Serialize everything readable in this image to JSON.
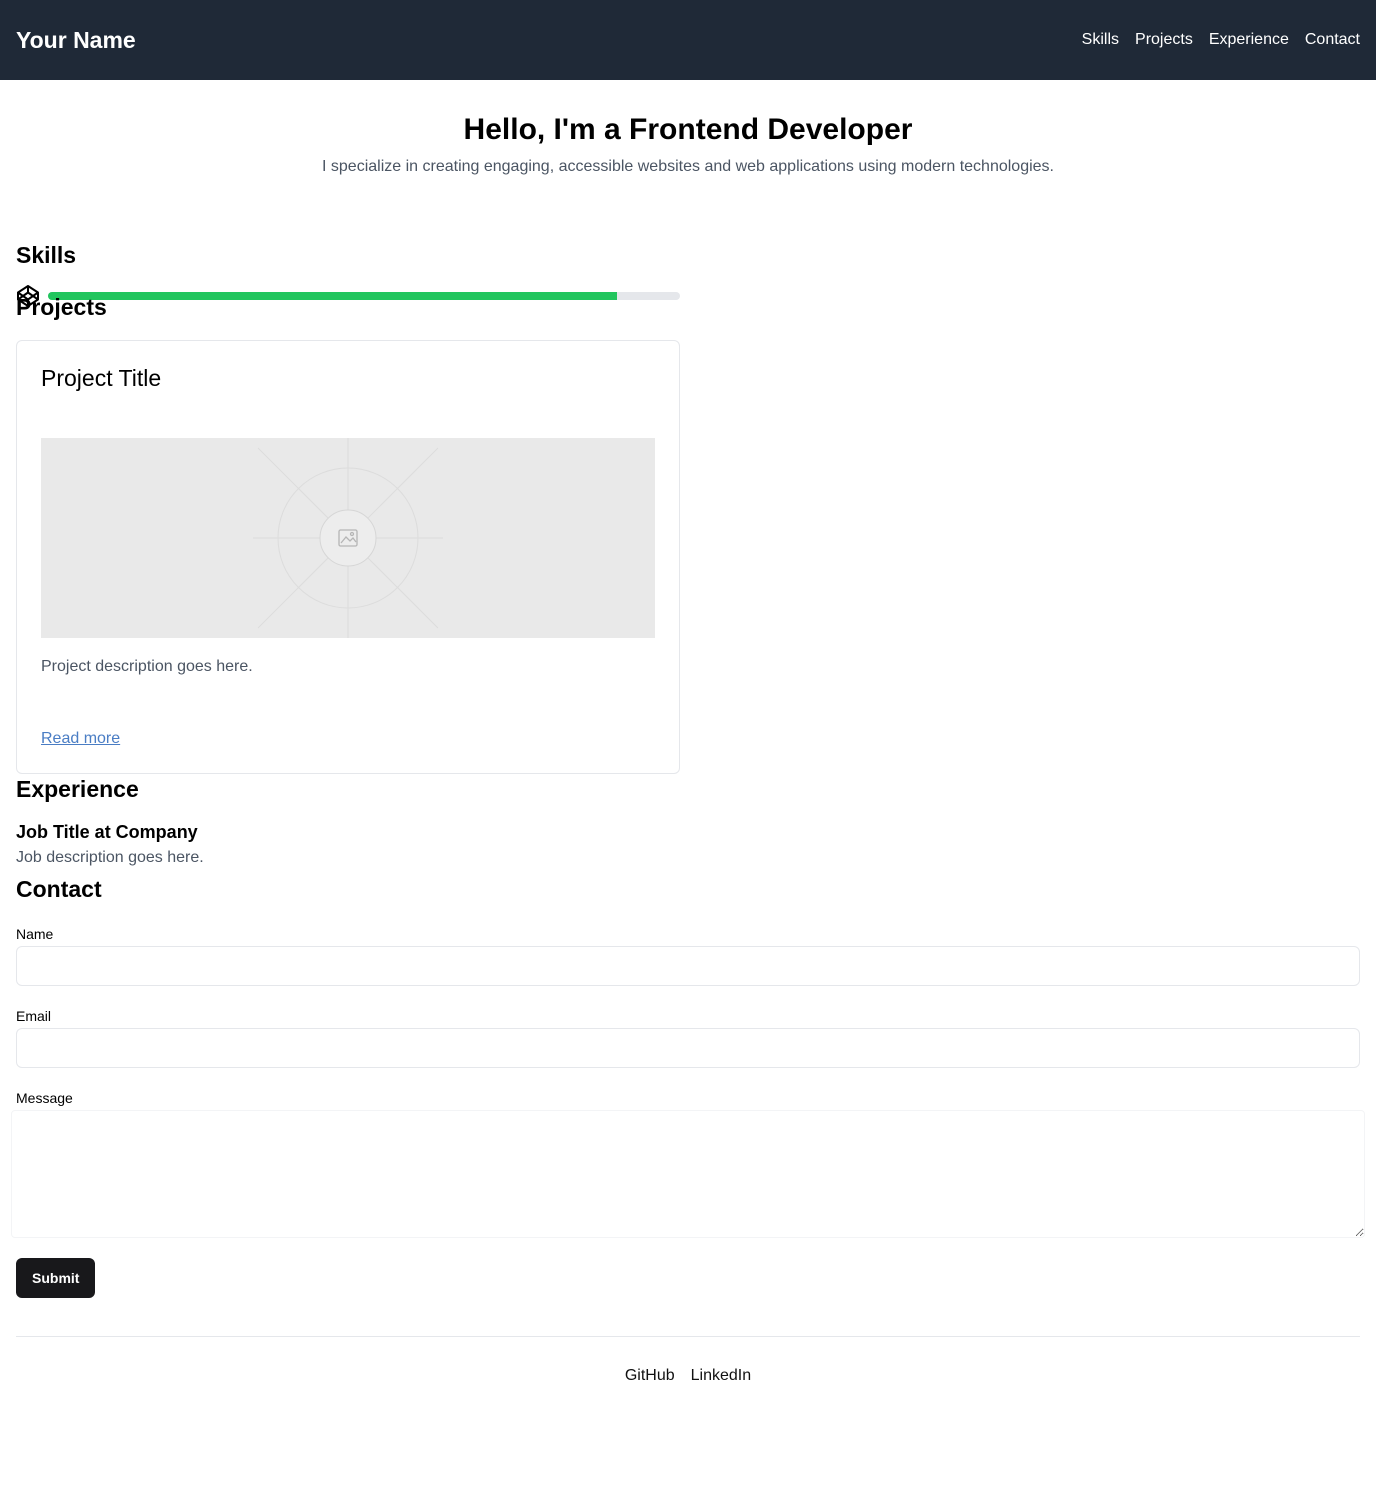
{
  "header": {
    "brand": "Your Name",
    "nav": [
      "Skills",
      "Projects",
      "Experience",
      "Contact"
    ],
    "background": "#1f2937"
  },
  "hero": {
    "title": "Hello, I'm a Frontend Developer",
    "subtitle": "I specialize in creating engaging, accessible websites and web applications using modern technologies."
  },
  "skills": {
    "heading": "Skills",
    "items": [
      {
        "icon": "codepen-icon",
        "level": 0.9,
        "color": "#22c55e"
      }
    ]
  },
  "projects": {
    "heading": "Projects",
    "items": [
      {
        "title": "Project Title",
        "image": "image-placeholder-icon",
        "description": "Project description goes here.",
        "link_label": "Read more"
      }
    ]
  },
  "experience": {
    "heading": "Experience",
    "items": [
      {
        "title": "Job Title at Company",
        "description": "Job description goes here."
      }
    ]
  },
  "contact": {
    "heading": "Contact",
    "fields": {
      "name_label": "Name",
      "name_value": "",
      "email_label": "Email",
      "email_value": "",
      "message_label": "Message",
      "message_value": ""
    },
    "submit_label": "Submit"
  },
  "footer": {
    "links": [
      "GitHub",
      "LinkedIn"
    ]
  },
  "colors": {
    "accent_link": "#4a7dc4",
    "progress": "#22c55e",
    "button": "#18181b"
  }
}
